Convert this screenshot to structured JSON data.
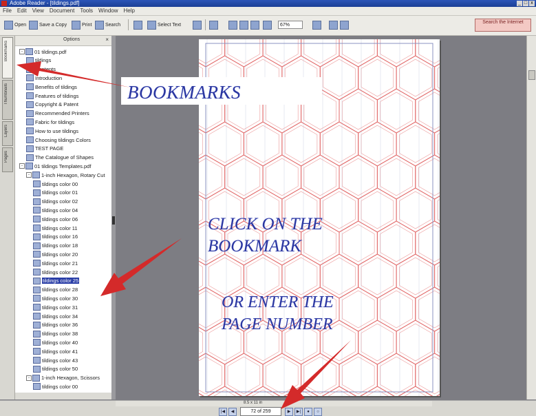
{
  "window": {
    "title": "Adobe Reader - [tildings.pdf]",
    "controls": [
      "_",
      "□",
      "x"
    ]
  },
  "menu": [
    "File",
    "Edit",
    "View",
    "Document",
    "Tools",
    "Window",
    "Help"
  ],
  "toolbar": {
    "open": "Open",
    "save_copy": "Save a Copy",
    "print": "Print",
    "search": "Search",
    "select_text": "Select Text",
    "zoom": "67%",
    "search_web": "Search the Internet"
  },
  "bookmarks": {
    "options": "Options",
    "items": [
      {
        "label": "01 tildings.pdf",
        "level": 0,
        "toggle": "-"
      },
      {
        "label": "tildings",
        "level": 1
      },
      {
        "label": "Contents",
        "level": 1
      },
      {
        "label": "Introduction",
        "level": 1
      },
      {
        "label": "Benefits of tildings",
        "level": 1
      },
      {
        "label": "Features of tildings",
        "level": 1
      },
      {
        "label": "Copyright & Patent",
        "level": 1
      },
      {
        "label": "Recommended Printers",
        "level": 1
      },
      {
        "label": "Fabric for tildings",
        "level": 1
      },
      {
        "label": "How to use tildings",
        "level": 1
      },
      {
        "label": "Choosing tildings Colors",
        "level": 1
      },
      {
        "label": "TEST PAGE",
        "level": 1
      },
      {
        "label": "The Catalogue of Shapes",
        "level": 1
      },
      {
        "label": "01 tildings Templates.pdf",
        "level": 0,
        "toggle": "-"
      },
      {
        "label": "1-inch Hexagon, Rotary Cut",
        "level": 1,
        "toggle": "-"
      },
      {
        "label": "tildings color 00",
        "level": 2
      },
      {
        "label": "tildings color 01",
        "level": 2
      },
      {
        "label": "tildings color 02",
        "level": 2
      },
      {
        "label": "tildings color 04",
        "level": 2
      },
      {
        "label": "tildings color 06",
        "level": 2
      },
      {
        "label": "tildings color 11",
        "level": 2
      },
      {
        "label": "tildings color 16",
        "level": 2
      },
      {
        "label": "tildings color 18",
        "level": 2
      },
      {
        "label": "tildings color 20",
        "level": 2
      },
      {
        "label": "tildings color 21",
        "level": 2
      },
      {
        "label": "tildings color 22",
        "level": 2
      },
      {
        "label": "tildings color 25",
        "level": 2,
        "selected": true
      },
      {
        "label": "tildings color 28",
        "level": 2
      },
      {
        "label": "tildings color 30",
        "level": 2
      },
      {
        "label": "tildings color 31",
        "level": 2
      },
      {
        "label": "tildings color 34",
        "level": 2
      },
      {
        "label": "tildings color 36",
        "level": 2
      },
      {
        "label": "tildings color 38",
        "level": 2
      },
      {
        "label": "tildings color 40",
        "level": 2
      },
      {
        "label": "tildings color 41",
        "level": 2
      },
      {
        "label": "tildings color 43",
        "level": 2
      },
      {
        "label": "tildings color 50",
        "level": 2
      },
      {
        "label": "1-inch Hexagon, Scissors",
        "level": 1,
        "toggle": "-"
      },
      {
        "label": "tildings color 00",
        "level": 2
      }
    ]
  },
  "nav_tabs": [
    "Bookmarks",
    "Thumbnails",
    "Layers",
    "Pages"
  ],
  "status": {
    "page_field": "72 of 259",
    "page_size": "8.5 x 11 in"
  },
  "annotations": {
    "bookmarks": "BOOKMARKS",
    "click_line1": "CLICK ON THE",
    "click_line2": "BOOKMARK",
    "enter_line1": "OR ENTER THE",
    "enter_line2": "PAGE NUMBER"
  },
  "colors": {
    "arrow": "#d42a2a",
    "annotation": "#2b37a0",
    "hexagon": "#e26a6a",
    "selection": "#2a3ea7"
  }
}
